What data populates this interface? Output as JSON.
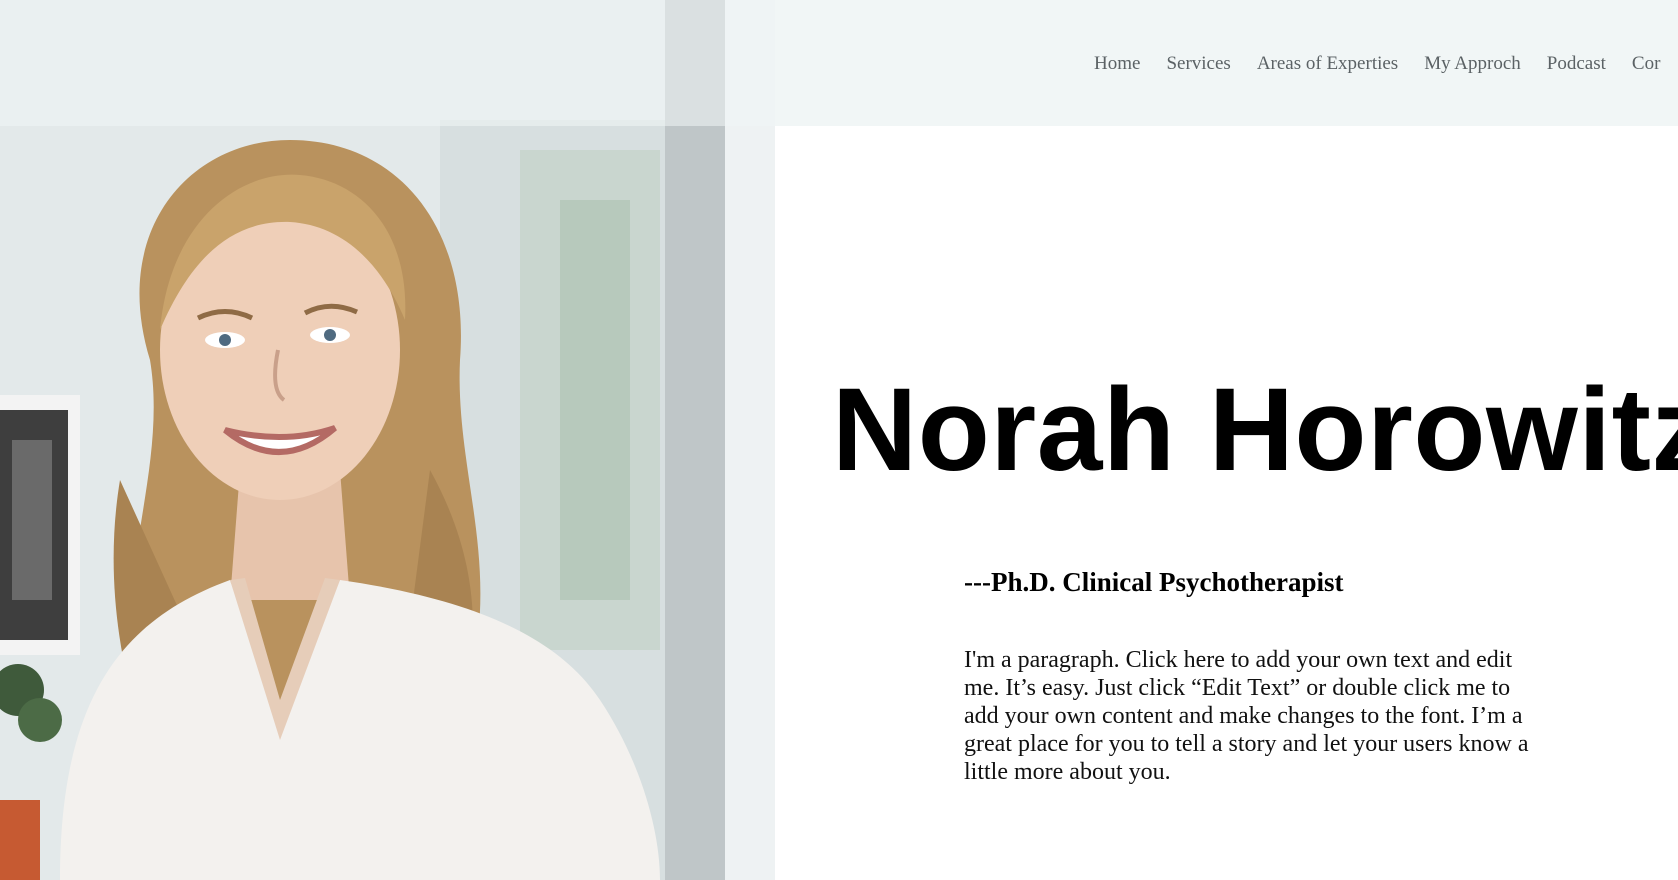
{
  "nav": {
    "items": [
      {
        "label": "Home"
      },
      {
        "label": "Services"
      },
      {
        "label": "Areas of Experties"
      },
      {
        "label": "My Approch"
      },
      {
        "label": "Podcast"
      },
      {
        "label": "Cor"
      }
    ]
  },
  "hero": {
    "name": "Norah Horowitz",
    "subtitle": "---Ph.D. Clinical Psychotherapist",
    "paragraph": "I'm a paragraph. Click here to add your own text and edit me. It’s easy. Just click “Edit Text” or double click me to add your own content and make changes to the font. I’m a great place for you to tell a story and let your users know a little more about you."
  },
  "colors": {
    "nav_text": "#5b6265",
    "header_bg": "#f1f6f6",
    "title_text": "#000000"
  }
}
